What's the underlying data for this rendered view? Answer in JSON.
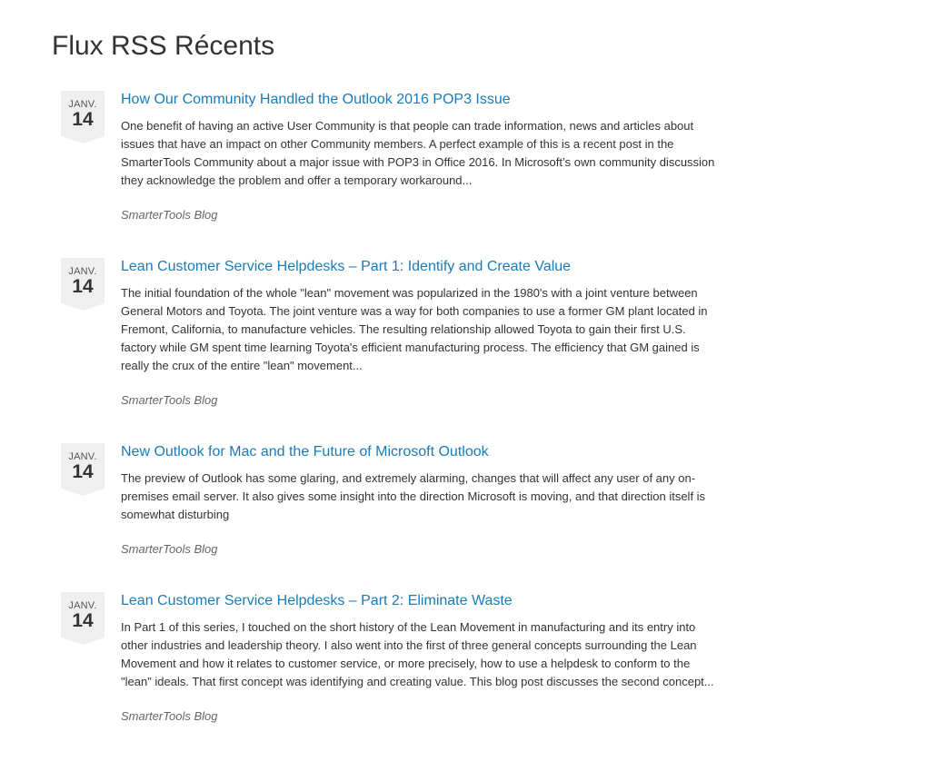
{
  "page": {
    "title": "Flux RSS Récents"
  },
  "feed": {
    "items": [
      {
        "month": "JANV.",
        "day": "14",
        "title": "How Our Community Handled the Outlook 2016 POP3 Issue",
        "description": "One benefit of having an active User Community is that people can trade information, news and articles about issues that have an impact on other Community members. A perfect example of this is a recent post in the SmarterTools Community about a major issue with POP3 in Office 2016. In Microsoft’s own community discussion they acknowledge the problem and offer a temporary workaround...",
        "source": "SmarterTools Blog"
      },
      {
        "month": "JANV.",
        "day": "14",
        "title": "Lean Customer Service Helpdesks – Part 1: Identify and Create Value",
        "description": "The initial foundation of the whole \"lean\" movement was popularized in the 1980's with a joint venture between General Motors and Toyota. The joint venture was a way for both companies to use a former GM plant located in Fremont, California, to manufacture vehicles. The resulting relationship allowed Toyota to gain their first U.S. factory while GM spent time learning Toyota's efficient manufacturing process. The efficiency that GM gained is really the crux of the entire \"lean\" movement...",
        "source": "SmarterTools Blog"
      },
      {
        "month": "JANV.",
        "day": "14",
        "title": "New Outlook for Mac and the Future of Microsoft Outlook",
        "description": "The preview of Outlook has some glaring, and extremely alarming, changes that will affect any user of any on-premises email server. It also gives some insight into the direction Microsoft is moving, and that direction itself is somewhat disturbing",
        "source": "SmarterTools Blog"
      },
      {
        "month": "JANV.",
        "day": "14",
        "title": "Lean Customer Service Helpdesks – Part 2: Eliminate Waste",
        "description": "In Part 1 of this series, I touched on the short history of the Lean Movement in manufacturing and its entry into other industries and leadership theory. I also went into the first of three general concepts surrounding the Lean Movement and how it relates to customer service, or more precisely, how to use a helpdesk to conform to the \"lean\" ideals. That first concept was identifying and creating value. This blog post discusses the second concept...",
        "source": "SmarterTools Blog"
      }
    ]
  }
}
